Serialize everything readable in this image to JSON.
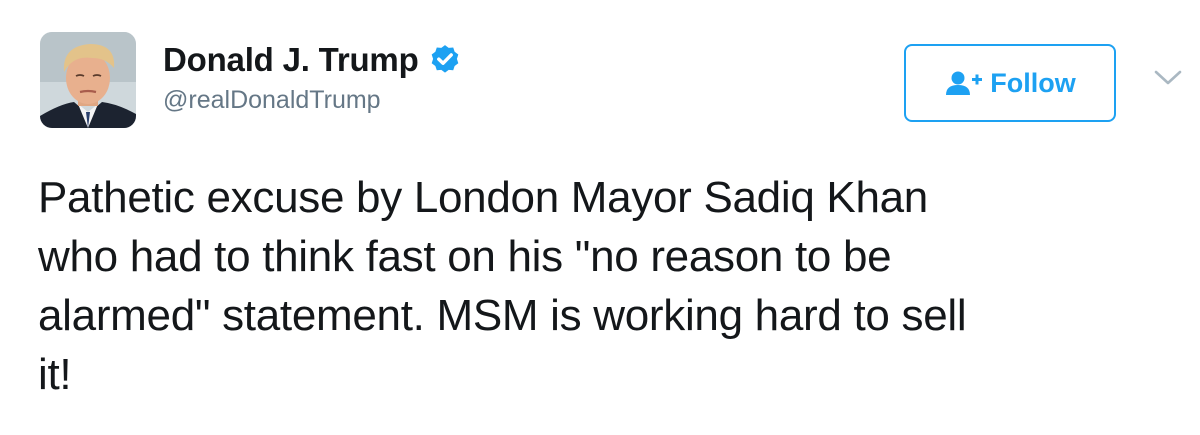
{
  "author": {
    "display_name": "Donald J. Trump",
    "handle": "@realDonaldTrump",
    "verified": true,
    "avatar_icon": "profile-photo"
  },
  "follow_button": {
    "label": "Follow",
    "icon": "add-user-icon"
  },
  "menu": {
    "icon": "chevron-down-icon"
  },
  "tweet": {
    "text": "Pathetic excuse by London Mayor Sadiq Khan\nwho had to think fast on his \"no reason to be\nalarmed\" statement. MSM is working hard to sell\nit!"
  },
  "colors": {
    "accent": "#1da1f2",
    "text": "#14171a",
    "secondary": "#657786",
    "chevron": "#aab8c2"
  }
}
